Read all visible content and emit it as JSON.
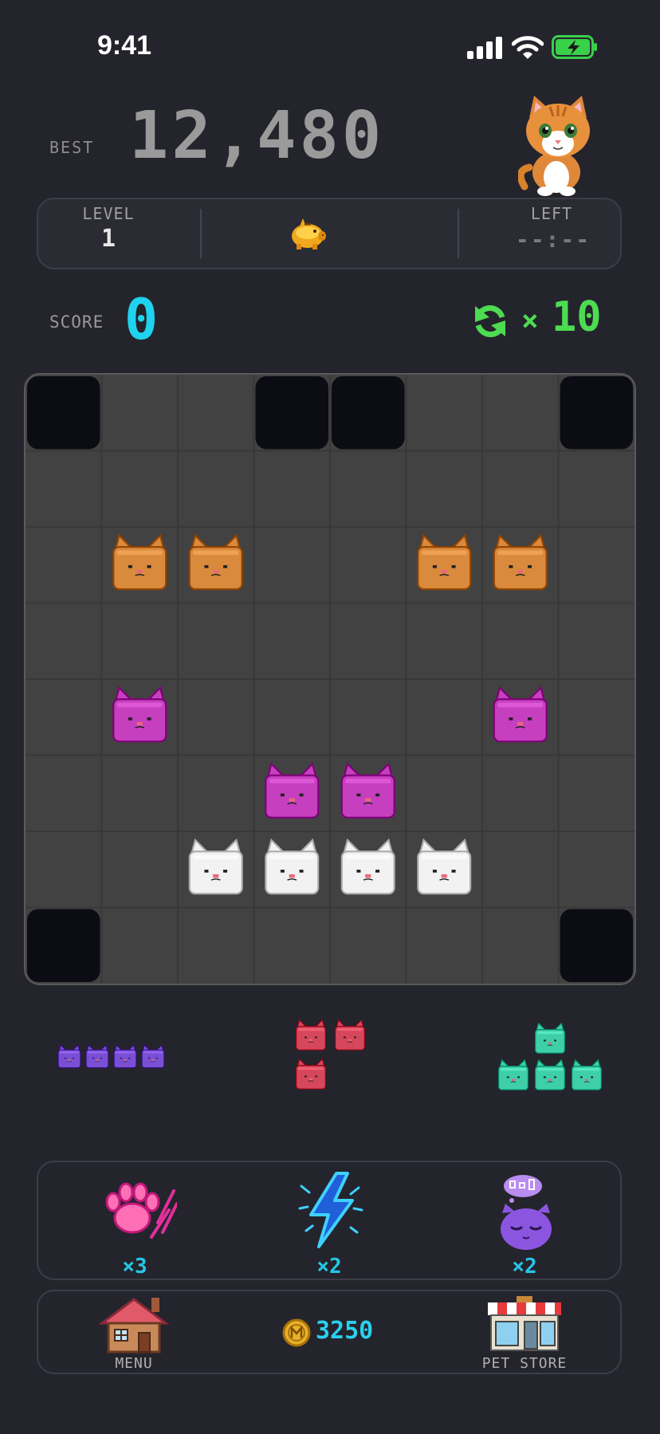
{
  "status_bar": {
    "time": "9:41"
  },
  "best": {
    "label": "BEST",
    "value": "12,480"
  },
  "info": {
    "level_label": "LEVEL",
    "level_value": "1",
    "left_label": "LEFT",
    "left_value": "--:--"
  },
  "score": {
    "label": "SCORE",
    "value": "0"
  },
  "refresh": {
    "multiplier": "×",
    "count": "10"
  },
  "board": {
    "columns": 8,
    "rows": 8,
    "blocked_cells": [
      [
        0,
        0
      ],
      [
        0,
        3
      ],
      [
        0,
        4
      ],
      [
        0,
        7
      ],
      [
        7,
        0
      ],
      [
        7,
        7
      ]
    ],
    "cats": [
      {
        "row": 2,
        "col": 1,
        "color": "orange"
      },
      {
        "row": 2,
        "col": 2,
        "color": "orange"
      },
      {
        "row": 2,
        "col": 5,
        "color": "orange"
      },
      {
        "row": 2,
        "col": 6,
        "color": "orange"
      },
      {
        "row": 4,
        "col": 1,
        "color": "magenta"
      },
      {
        "row": 4,
        "col": 6,
        "color": "magenta"
      },
      {
        "row": 5,
        "col": 3,
        "color": "magenta"
      },
      {
        "row": 5,
        "col": 4,
        "color": "magenta"
      },
      {
        "row": 6,
        "col": 2,
        "color": "white"
      },
      {
        "row": 6,
        "col": 3,
        "color": "white"
      },
      {
        "row": 6,
        "col": 4,
        "color": "white"
      },
      {
        "row": 6,
        "col": 5,
        "color": "white"
      }
    ]
  },
  "cat_colors": {
    "orange": "#d98a3c",
    "magenta": "#c53fbf",
    "white": "#f2f2f2",
    "purple": "#7a4fd6",
    "red": "#d6475b",
    "teal": "#3ecfa9"
  },
  "tray": [
    {
      "name": "piece-purple-line",
      "color": "purple",
      "cells": [
        [
          0,
          0
        ],
        [
          0,
          1
        ],
        [
          0,
          2
        ],
        [
          0,
          3
        ]
      ]
    },
    {
      "name": "piece-red-l",
      "color": "red",
      "cells": [
        [
          0,
          0
        ],
        [
          0,
          1
        ],
        [
          1,
          0
        ]
      ]
    },
    {
      "name": "piece-teal-t",
      "color": "teal",
      "cells": [
        [
          0,
          1
        ],
        [
          1,
          0
        ],
        [
          1,
          1
        ],
        [
          1,
          2
        ]
      ]
    }
  ],
  "powerups": [
    {
      "icon": "paw-scratch-icon",
      "count": "×3"
    },
    {
      "icon": "lightning-icon",
      "count": "×2"
    },
    {
      "icon": "dreaming-cat-icon",
      "count": "×2"
    }
  ],
  "bottom_bar": {
    "menu_label": "MENU",
    "coins": "3250",
    "store_label": "PET STORE"
  }
}
